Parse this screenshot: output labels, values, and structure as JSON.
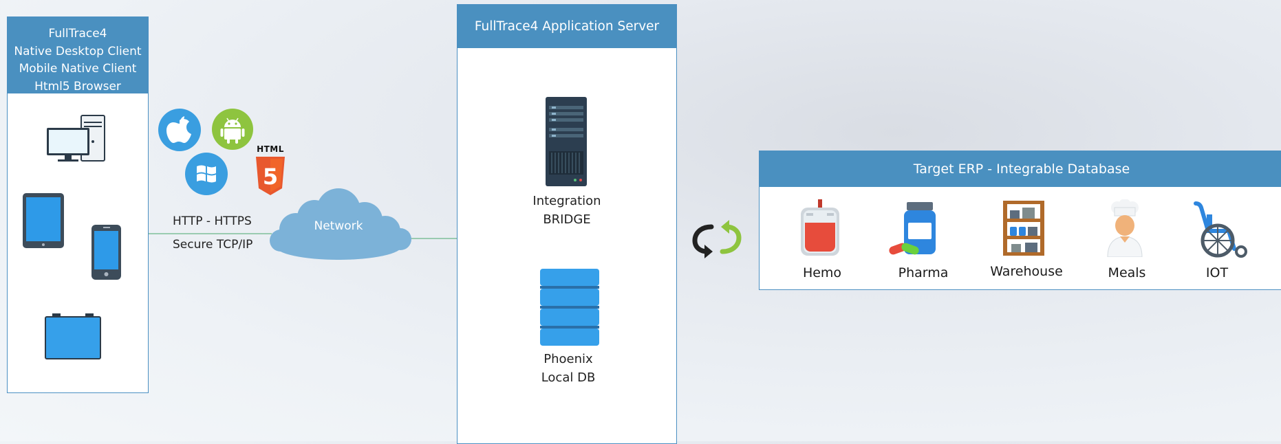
{
  "client": {
    "lines": [
      "FullTrace4",
      "Native Desktop Client",
      "Mobile Native Client",
      "Html5 Browser"
    ]
  },
  "connection": {
    "protocol": "HTTP - HTTPS",
    "transport": "Secure TCP/IP",
    "network": "Network"
  },
  "platform_icons": {
    "apple": "apple-icon",
    "android": "android-icon",
    "windows": "windows-icon",
    "html5_label": "HTML",
    "html5_number": "5"
  },
  "server": {
    "title": "FullTrace4 Application Server",
    "integration": [
      "Integration",
      "BRIDGE"
    ],
    "db": [
      "Phoenix",
      "Local DB"
    ]
  },
  "erp": {
    "title": "Target  ERP  -  Integrable Database",
    "modules": [
      "Hemo",
      "Pharma",
      "Warehouse",
      "Meals",
      "IOT"
    ]
  },
  "colors": {
    "header_blue": "#4a90c0",
    "accent_blue": "#3a9ee0",
    "android_green": "#8ec43f",
    "html5_orange": "#e8582e",
    "line_green": "#7fbf9a"
  }
}
